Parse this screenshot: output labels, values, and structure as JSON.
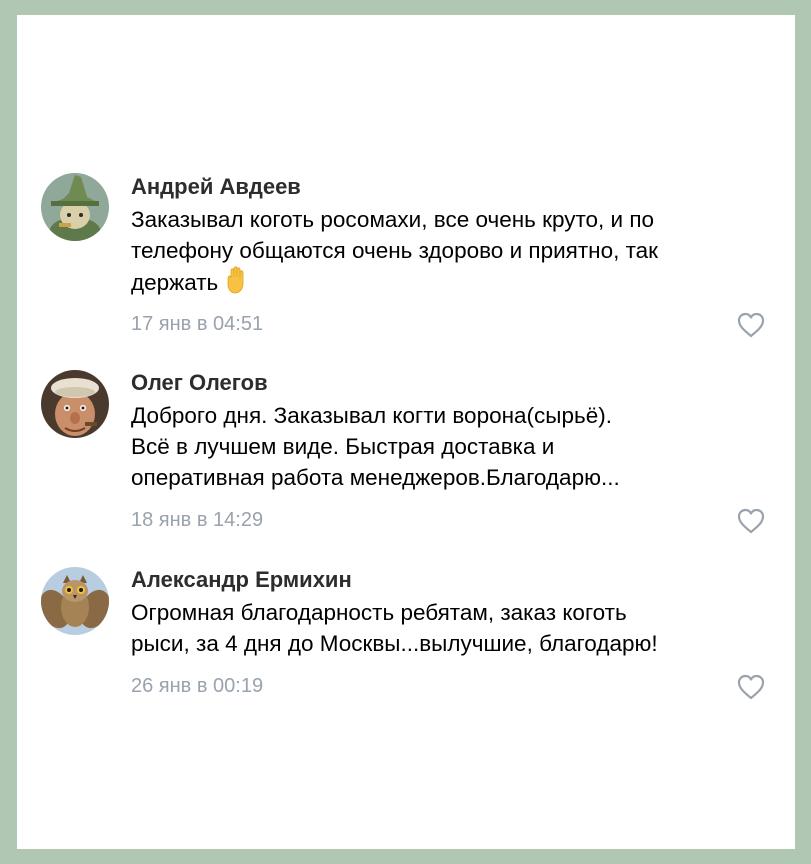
{
  "comments": [
    {
      "author": "Андрей Авдеев",
      "avatar_icon": "snufkin-avatar-icon",
      "lines": [
        "Заказывал коготь росомахи, все очень круто, и по",
        "телефону общаются очень здорово и приятно, так",
        "держать"
      ],
      "emoji": "raised-hand-emoji",
      "date": "17 янв в 04:51",
      "like_icon": "heart-outline-icon"
    },
    {
      "author": "Олег Олегов",
      "avatar_icon": "old-man-avatar-icon",
      "lines": [
        "Доброго дня. Заказывал когти ворона(сырьё).",
        "Всё в лучшем виде. Быстрая доставка и",
        "оперативная работа менеджеров.Благодарю..."
      ],
      "date": "18 янв в 14:29",
      "like_icon": "heart-outline-icon"
    },
    {
      "author": "Александр Ермихин",
      "avatar_icon": "owl-avatar-icon",
      "lines": [
        "Огромная благодарность ребятам, заказ коготь",
        "рыси, за 4 дня до Москвы...вылучшие, благодарю!"
      ],
      "date": "26 янв в 00:19",
      "like_icon": "heart-outline-icon"
    }
  ],
  "colors": {
    "frame": "#b0c8b3",
    "author": "#2c2d2e",
    "date": "#99a2ad",
    "heart": "#99a2ad"
  }
}
